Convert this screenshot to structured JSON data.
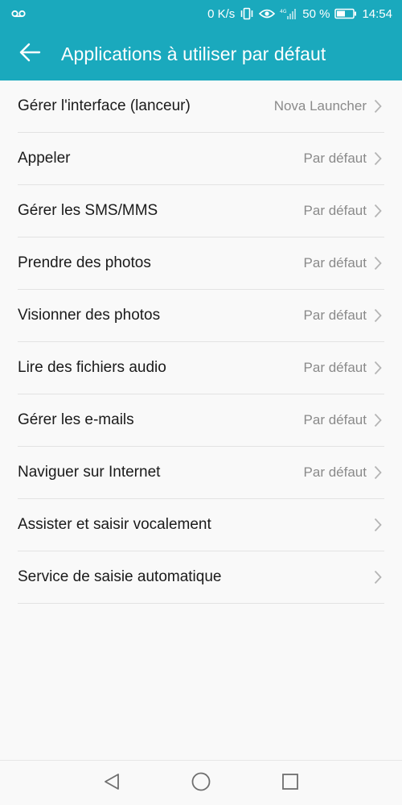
{
  "status_bar": {
    "speed": "0 K/s",
    "battery": "50 %",
    "time": "14:54",
    "icons": [
      "voicemail-icon",
      "vibrate-icon",
      "eye-icon",
      "signal-icon",
      "battery-icon"
    ]
  },
  "header": {
    "title": "Applications à utiliser par défaut",
    "back_icon": "arrow-back-icon",
    "background": "#1aa9bd"
  },
  "settings": [
    {
      "label": "Gérer l'interface (lanceur)",
      "value": "Nova Launcher"
    },
    {
      "label": "Appeler",
      "value": "Par défaut"
    },
    {
      "label": "Gérer les SMS/MMS",
      "value": "Par défaut"
    },
    {
      "label": "Prendre des photos",
      "value": "Par défaut"
    },
    {
      "label": "Visionner des photos",
      "value": "Par défaut"
    },
    {
      "label": "Lire des fichiers audio",
      "value": "Par défaut"
    },
    {
      "label": "Gérer les e-mails",
      "value": "Par défaut"
    },
    {
      "label": "Naviguer sur Internet",
      "value": "Par défaut"
    },
    {
      "label": "Assister et saisir vocalement",
      "value": ""
    },
    {
      "label": "Service de saisie automatique",
      "value": ""
    }
  ],
  "nav": {
    "icons": [
      "back-triangle-icon",
      "home-circle-icon",
      "recents-square-icon"
    ]
  }
}
